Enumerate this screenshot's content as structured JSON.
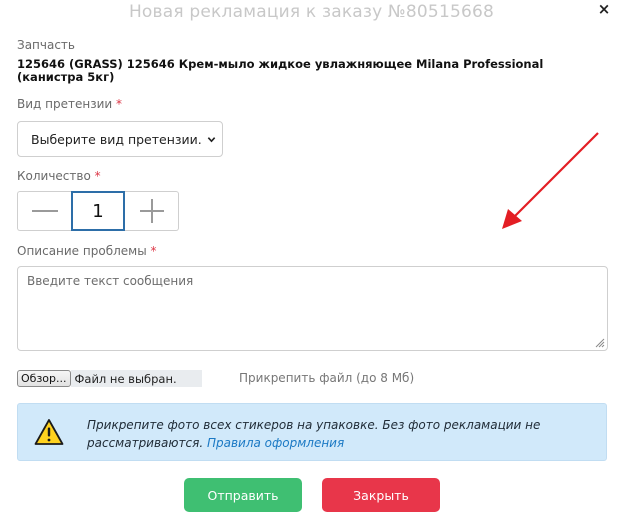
{
  "modal": {
    "title": "Новая рекламация к заказу №80515668",
    "close_symbol": "×"
  },
  "part": {
    "label": "Запчасть",
    "name": "125646 (GRASS) 125646 Крем-мыло жидкое увлажняющее Milana Professional (канистра 5кг)"
  },
  "claim_type": {
    "label": "Вид претензии",
    "required_mark": "*",
    "selected": "Выберите вид претензии."
  },
  "quantity": {
    "label": "Количество",
    "required_mark": "*",
    "value": "1"
  },
  "description": {
    "label": "Описание проблемы",
    "required_mark": "*",
    "placeholder": "Введите текст сообщения"
  },
  "file": {
    "button_label": "Обзор...",
    "status": "Файл не выбран.",
    "hint": "Прикрепить файл (до 8 Мб)"
  },
  "alert": {
    "text": "Прикрепите фото всех стикеров на упаковке. Без фото рекламации не рассматриваются.",
    "link": "Правила оформления"
  },
  "actions": {
    "submit": "Отправить",
    "close": "Закрыть"
  },
  "colors": {
    "submit": "#3fbf72",
    "close": "#e8364a",
    "alert_bg": "#d1e9fa",
    "stepper_focus": "#2d6ea8",
    "arrow": "#e31e24"
  }
}
